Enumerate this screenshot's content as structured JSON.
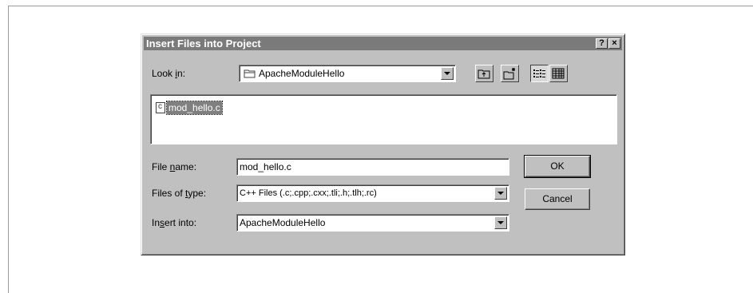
{
  "dialog": {
    "title": "Insert Files into Project",
    "help_label": "?",
    "close_label": "×"
  },
  "look_in": {
    "label_prefix": "Look ",
    "label_accel": "i",
    "label_suffix": "n:",
    "value": "ApacheModuleHello"
  },
  "file_list": {
    "items": [
      {
        "name": "mod_hello.c",
        "selected": true,
        "icon": "c-source-file-icon"
      }
    ]
  },
  "file_name": {
    "label_prefix": "File ",
    "label_accel": "n",
    "label_suffix": "ame:",
    "value": "mod_hello.c"
  },
  "files_of_type": {
    "label_prefix": "Files of ",
    "label_accel": "t",
    "label_suffix": "ype:",
    "value": "C++ Files (.c;.cpp;.cxx;.tli;.h;.tlh;.rc)"
  },
  "insert_into": {
    "label_prefix": "In",
    "label_accel": "s",
    "label_suffix": "ert into:",
    "value": "ApacheModuleHello"
  },
  "buttons": {
    "ok": "OK",
    "cancel": "Cancel"
  },
  "toolbar": {
    "icons": [
      "up-one-level-icon",
      "create-new-folder-icon",
      "list-view-icon",
      "details-view-icon"
    ]
  }
}
